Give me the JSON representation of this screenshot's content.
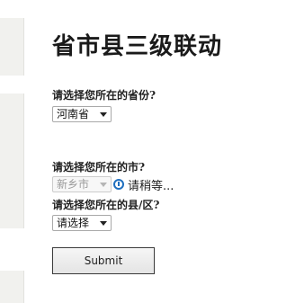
{
  "page": {
    "title": "省市县三级联动"
  },
  "form": {
    "province": {
      "label": "请选择您所在的省份?",
      "selected": "河南省"
    },
    "city": {
      "label": "请选择您所在的市?",
      "selected": "新乡市",
      "loading_text": "请稍等..."
    },
    "county": {
      "label": "请选择您所在的县/区?",
      "selected": "请选择"
    },
    "submit_label": "Submit"
  },
  "icons": {
    "loading": "info-icon"
  },
  "colors": {
    "background": "#ffffff",
    "sidebar_panel": "#f1f1ee",
    "info_icon": "#1f6fbf",
    "disabled_text": "#9a9a9a"
  }
}
